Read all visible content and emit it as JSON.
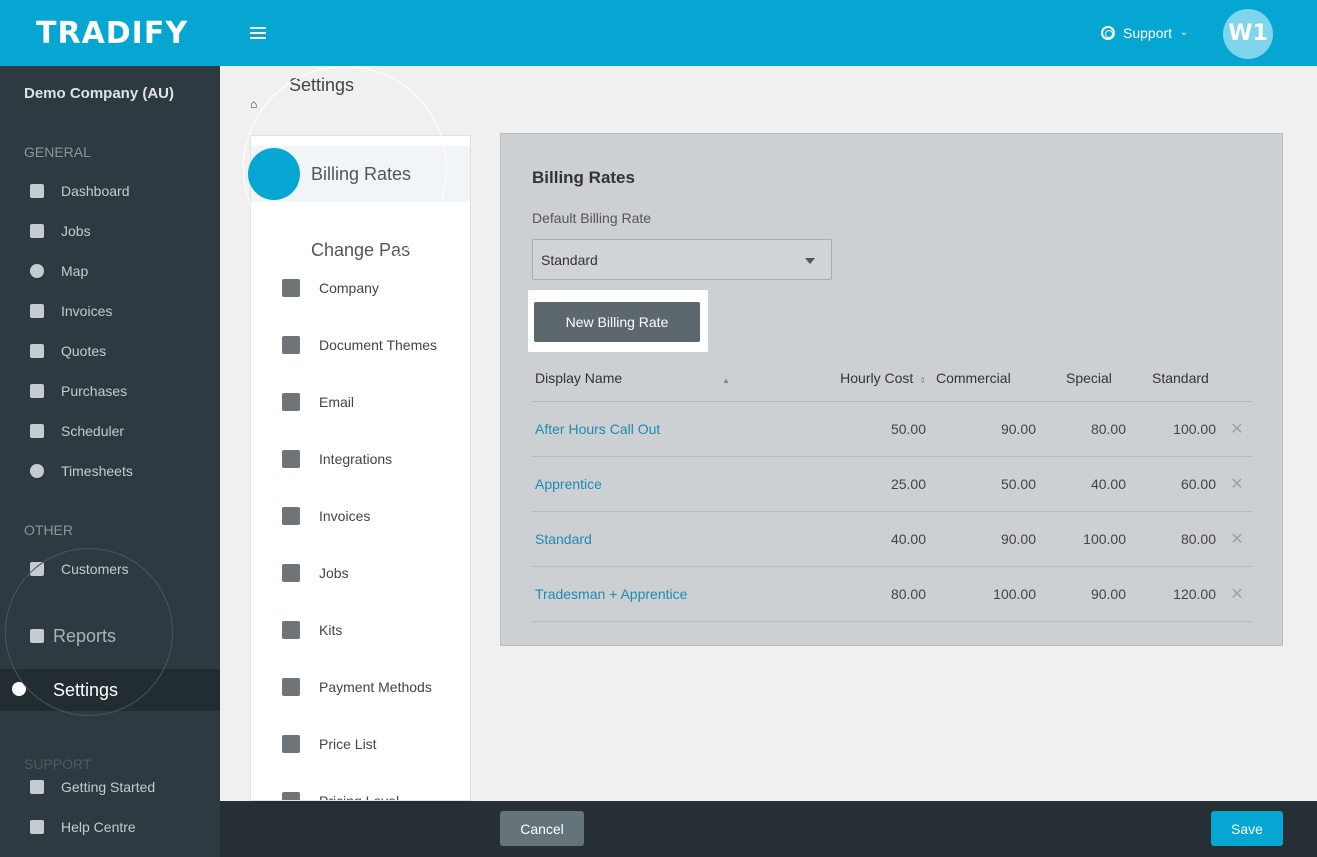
{
  "app": {
    "logo": "TRADIFY",
    "support_label": "Support",
    "avatar_initials": "W1",
    "brand_color": "#05a6d2"
  },
  "sidebar": {
    "company_name": "Demo Company (AU)",
    "general_heading": "GENERAL",
    "general_items": [
      {
        "label": "Dashboard",
        "icon": "dashboard-icon"
      },
      {
        "label": "Jobs",
        "icon": "hammer-icon"
      },
      {
        "label": "Map",
        "icon": "map-pin-icon"
      },
      {
        "label": "Invoices",
        "icon": "invoice-icon"
      },
      {
        "label": "Quotes",
        "icon": "calculator-icon"
      },
      {
        "label": "Purchases",
        "icon": "cart-icon"
      },
      {
        "label": "Scheduler",
        "icon": "calendar-icon"
      },
      {
        "label": "Timesheets",
        "icon": "clock-icon"
      }
    ],
    "other_heading": "OTHER",
    "other_items": [
      {
        "label": "Customers",
        "icon": "users-icon"
      },
      {
        "label": "Reports",
        "icon": "chart-icon"
      },
      {
        "label": "Settings",
        "icon": "gear-icon"
      }
    ],
    "support_heading": "SUPPORT",
    "support_items": [
      {
        "label": "Getting Started",
        "icon": "thumbs-up-icon"
      },
      {
        "label": "Help Centre",
        "icon": "book-icon"
      }
    ]
  },
  "settings_nav": {
    "page_title": "Settings",
    "items": [
      {
        "label": "Billing Rates",
        "icon": "person-icon"
      },
      {
        "label": "Change Pas",
        "icon": "spinner-icon"
      },
      {
        "label": "Company",
        "icon": "home-icon"
      },
      {
        "label": "Document Themes",
        "icon": "copy-icon"
      },
      {
        "label": "Email",
        "icon": "envelope-icon"
      },
      {
        "label": "Integrations",
        "icon": "link-icon"
      },
      {
        "label": "Invoices",
        "icon": "file-icon"
      },
      {
        "label": "Jobs",
        "icon": "hammer-icon"
      },
      {
        "label": "Kits",
        "icon": "cubes-icon"
      },
      {
        "label": "Payment Methods",
        "icon": "money-icon"
      },
      {
        "label": "Price List",
        "icon": "book-icon"
      },
      {
        "label": "Pricing Level",
        "icon": "percent-icon"
      }
    ]
  },
  "billing": {
    "title": "Billing Rates",
    "default_label": "Default Billing Rate",
    "default_value": "Standard",
    "new_button": "New Billing Rate",
    "columns": [
      "Display Name",
      "Hourly Cost",
      "Commercial",
      "Special",
      "Standard"
    ],
    "rows": [
      {
        "name": "After Hours Call Out",
        "hourly_cost": "50.00",
        "commercial": "90.00",
        "special": "80.00",
        "standard": "100.00"
      },
      {
        "name": "Apprentice",
        "hourly_cost": "25.00",
        "commercial": "50.00",
        "special": "40.00",
        "standard": "60.00"
      },
      {
        "name": "Standard",
        "hourly_cost": "40.00",
        "commercial": "90.00",
        "special": "100.00",
        "standard": "80.00"
      },
      {
        "name": "Tradesman + Apprentice",
        "hourly_cost": "80.00",
        "commercial": "100.00",
        "special": "90.00",
        "standard": "120.00"
      }
    ]
  },
  "footer": {
    "cancel_label": "Cancel",
    "save_label": "Save"
  }
}
